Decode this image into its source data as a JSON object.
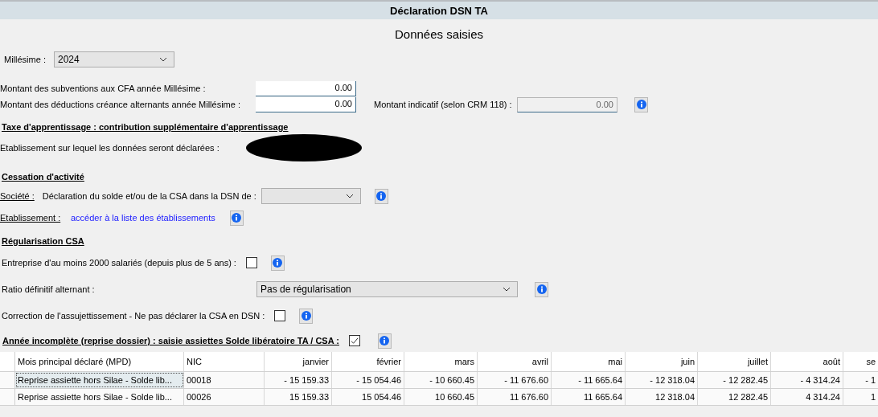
{
  "window": {
    "title": "Déclaration DSN TA"
  },
  "heading": "Données saisies",
  "millesime": {
    "label": "Millésime :",
    "value": "2024"
  },
  "amounts": [
    {
      "label": "Montant des subventions aux CFA année Millésime :",
      "value": "0.00"
    },
    {
      "label": "Montant des déductions créance alternants année Millésime :",
      "value": "0.00"
    }
  ],
  "indicative": {
    "label": "Montant indicatif (selon CRM 118) :",
    "value": "0.00",
    "disabled": true
  },
  "apprenticeship_tax": {
    "heading": "Taxe d'apprentissage : contribution supplémentaire d'apprentissage",
    "establishment_label": "Etablissement sur lequel les données seront déclarées :"
  },
  "cessation": {
    "heading": "Cessation d'activité",
    "company_label": "Société :",
    "company_text": "Déclaration du solde et/ou de la CSA dans la DSN de :",
    "establishment_label": "Etablissement :",
    "establishment_link": "accéder à la liste des établissements"
  },
  "regularisation": {
    "heading": "Régularisation CSA",
    "options": [
      {
        "kind": "checkbox",
        "label": "Entreprise d'au moins 2000 salariés (depuis plus de 5 ans) :",
        "checked": false
      },
      {
        "kind": "select",
        "label": "Ratio définitif alternant :",
        "value": "Pas de régularisation"
      },
      {
        "kind": "checkbox",
        "label": "Correction de l'assujettissement - Ne pas déclarer la CSA en DSN :",
        "checked": false
      }
    ]
  },
  "incomplete_year": {
    "label": "Année incomplète (reprise dossier) : saisie assiettes Solde libératoire TA / CSA :",
    "checked": true
  },
  "table": {
    "columns": [
      "Mois principal déclaré (MPD)",
      "NIC",
      "janvier",
      "février",
      "mars",
      "avril",
      "mai",
      "juin",
      "juillet",
      "août",
      "se"
    ],
    "rows": [
      {
        "selected": true,
        "cells": [
          "Reprise assiette hors Silae - Solde lib...",
          "00018",
          "- 15 159.33",
          "- 15 054.46",
          "- 10 660.45",
          "- 11 676.60",
          "- 11 665.64",
          "- 12 318.04",
          "- 12 282.45",
          "- 4 314.24",
          "- 1"
        ]
      },
      {
        "selected": false,
        "cells": [
          "Reprise assiette hors Silae - Solde lib...",
          "00026",
          "15 159.33",
          "15 054.46",
          "10 660.45",
          "11 676.60",
          "11 665.64",
          "12 318.04",
          "12 282.45",
          "4 314.24",
          "1"
        ]
      }
    ]
  }
}
